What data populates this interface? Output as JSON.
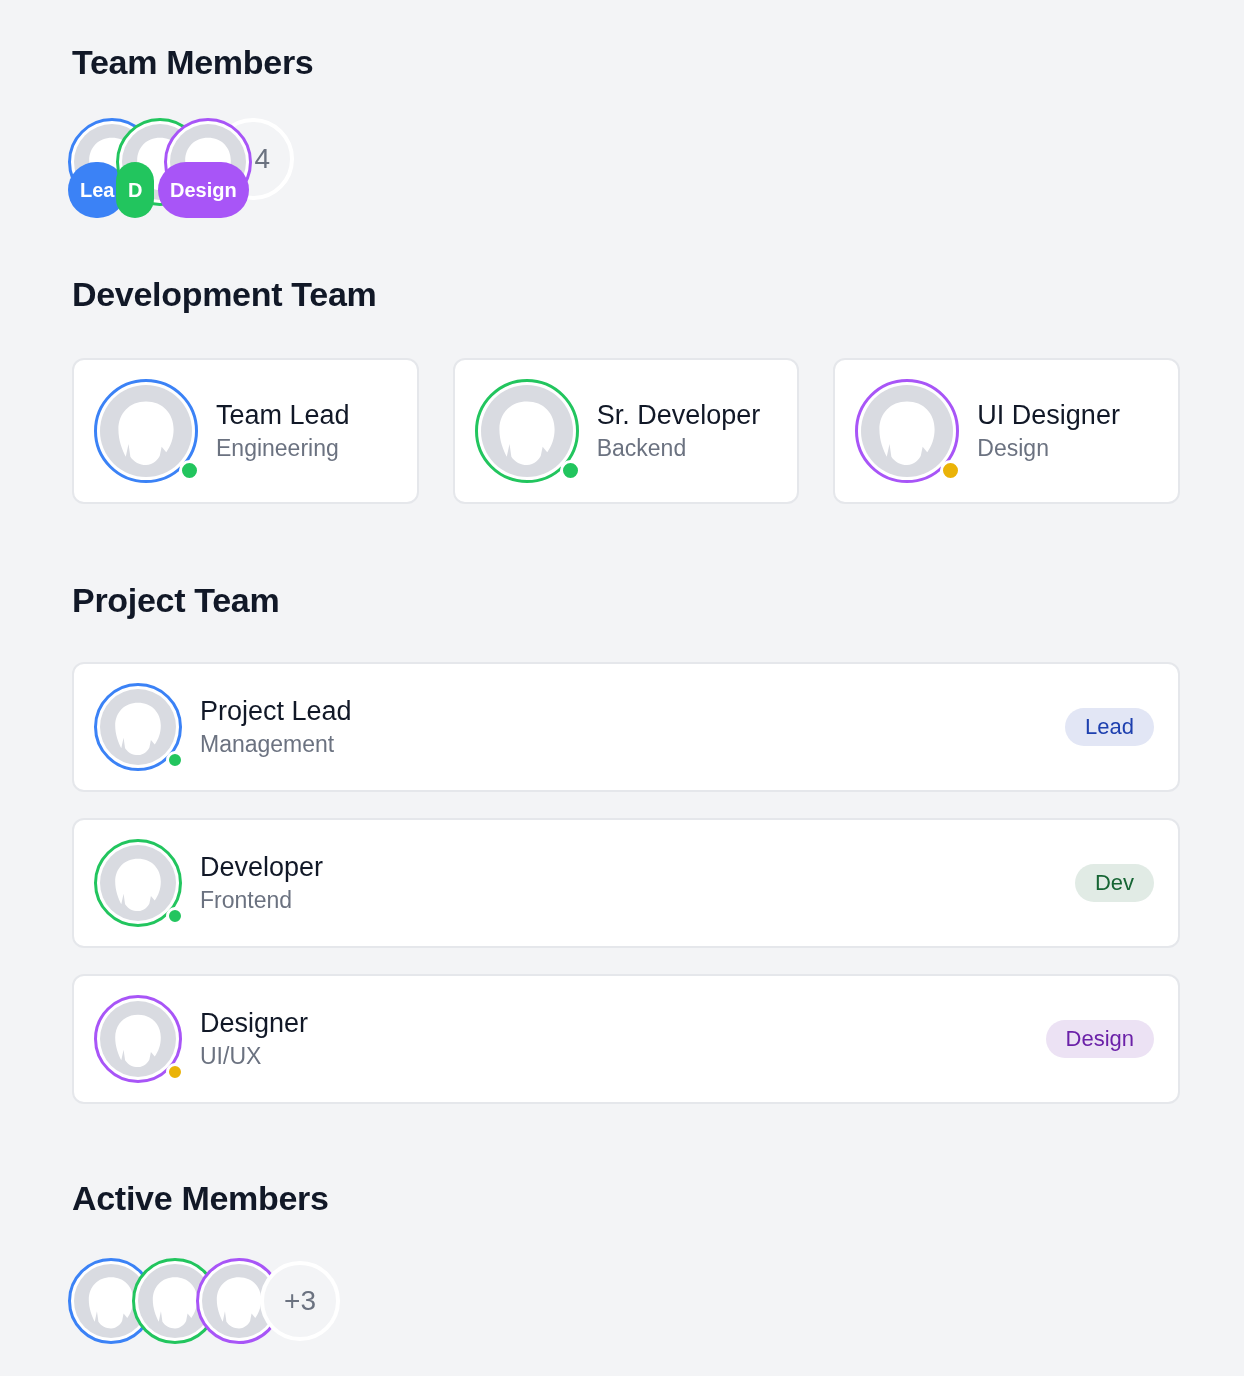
{
  "sections": [
    {
      "kind": "badged-stack",
      "title": "Team Members",
      "members": [
        {
          "color": "#3b82f6",
          "badge": "Lea"
        },
        {
          "color": "#22c55e",
          "badge": "D"
        },
        {
          "color": "#a855f7",
          "badge": "Design"
        }
      ],
      "more": "4"
    },
    {
      "kind": "cards",
      "title": "Development Team",
      "members": [
        {
          "name": "Team Lead",
          "role": "Engineering",
          "color": "#3b82f6",
          "status_dot": {
            "color": "#22c55e"
          }
        },
        {
          "name": "Sr. Developer",
          "role": "Backend",
          "color": "#22c55e",
          "status_dot": {
            "color": "#22c55e"
          }
        },
        {
          "name": "UI Designer",
          "role": "Design",
          "color": "#a855f7",
          "status_dot": {
            "color": "#eab308"
          }
        }
      ]
    },
    {
      "kind": "list",
      "title": "Project Team",
      "members": [
        {
          "name": "Project Lead",
          "role": "Management",
          "color": "#3b82f6",
          "status_dot": {
            "color": "#22c55e"
          },
          "tag": {
            "label": "Lead",
            "color": "#1e40af"
          }
        },
        {
          "name": "Developer",
          "role": "Frontend",
          "color": "#22c55e",
          "status_dot": {
            "color": "#22c55e"
          },
          "tag": {
            "label": "Dev",
            "color": "#166534"
          }
        },
        {
          "name": "Designer",
          "role": "UI/UX",
          "color": "#a855f7",
          "status_dot": {
            "color": "#eab308"
          },
          "tag": {
            "label": "Design",
            "color": "#6b21a8"
          }
        }
      ]
    },
    {
      "kind": "stack",
      "title": "Active Members",
      "members": [
        {
          "color": "#3b82f6"
        },
        {
          "color": "#22c55e"
        },
        {
          "color": "#a855f7"
        }
      ],
      "more": "+3"
    }
  ]
}
